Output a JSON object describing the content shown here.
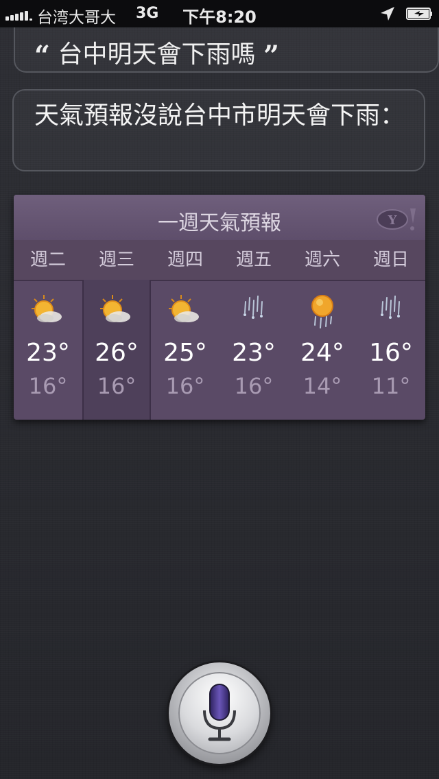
{
  "status_bar": {
    "carrier": "台湾大哥大",
    "network": "3G",
    "time": "下午8:20",
    "signal_bars": 5
  },
  "conversation": {
    "user_query": "台中明天會下雨嗎",
    "open_quote": "“",
    "close_quote": "”",
    "siri_response": "天氣預報沒說台中市明天會下雨："
  },
  "weather_card": {
    "title": "一週天氣預報",
    "provider_logo": "yahoo-logo",
    "days": [
      {
        "day": "週二",
        "high": "23°",
        "low": "16°",
        "icon": "sun-cloud-icon",
        "selected": false
      },
      {
        "day": "週三",
        "high": "26°",
        "low": "16°",
        "icon": "sun-cloud-icon",
        "selected": true
      },
      {
        "day": "週四",
        "high": "25°",
        "low": "16°",
        "icon": "sun-cloud-icon",
        "selected": false
      },
      {
        "day": "週五",
        "high": "23°",
        "low": "16°",
        "icon": "rain-icon",
        "selected": false
      },
      {
        "day": "週六",
        "high": "24°",
        "low": "14°",
        "icon": "sun-rain-icon",
        "selected": false
      },
      {
        "day": "週日",
        "high": "16°",
        "low": "11°",
        "icon": "rain-icon",
        "selected": false
      }
    ]
  },
  "controls": {
    "mic_button": "microphone-icon"
  },
  "colors": {
    "card_bg": "#5a4a66",
    "background": "#2a2b30",
    "mic_accent": "#4a3a8a"
  }
}
